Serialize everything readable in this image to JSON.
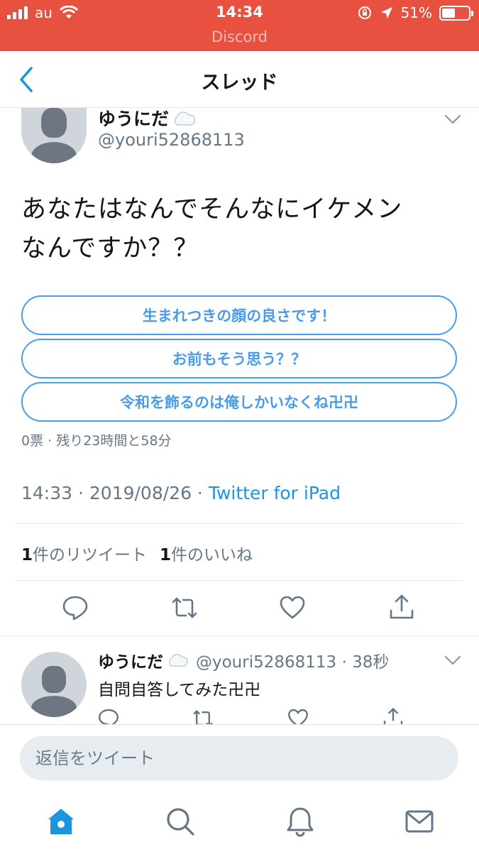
{
  "status_bar": {
    "carrier": "au",
    "time": "14:34",
    "battery": "51%",
    "battery_level": 0.51,
    "return_app": "Discord"
  },
  "header": {
    "title": "スレッド"
  },
  "tweet": {
    "display_name": "ゆうにだ",
    "name_emoji": "☁️",
    "handle": "@youri52868113",
    "text_line1": "あなたはなんでそんなにイケメン",
    "text_line2": "なんですか？？",
    "poll": {
      "options": [
        "生まれつきの顔の良さです！",
        "お前もそう思う？？",
        "令和を飾るのは俺しかいなくね卍卍"
      ],
      "meta": "0票 · 残り23時間と58分"
    },
    "timestamp": "14:33 · 2019/08/26 · ",
    "source": "Twitter for iPad",
    "retweet_count": "1",
    "retweet_label": "件のリツイート",
    "like_count": "1",
    "like_label": "件のいいね"
  },
  "reply": {
    "display_name": "ゆうにだ",
    "name_emoji": "☁️",
    "handle": "@youri52868113",
    "time": "38秒",
    "text": "自問自答してみた卍卍"
  },
  "composer": {
    "placeholder": "返信をツイート"
  },
  "tabbar": {
    "tabs": [
      "home-icon",
      "search-icon",
      "bell-icon",
      "mail-icon"
    ]
  },
  "colors": {
    "status_bar": "#e8503f",
    "accent": "#1b95e0",
    "poll_border": "#4a9ce8",
    "muted": "#657786"
  }
}
